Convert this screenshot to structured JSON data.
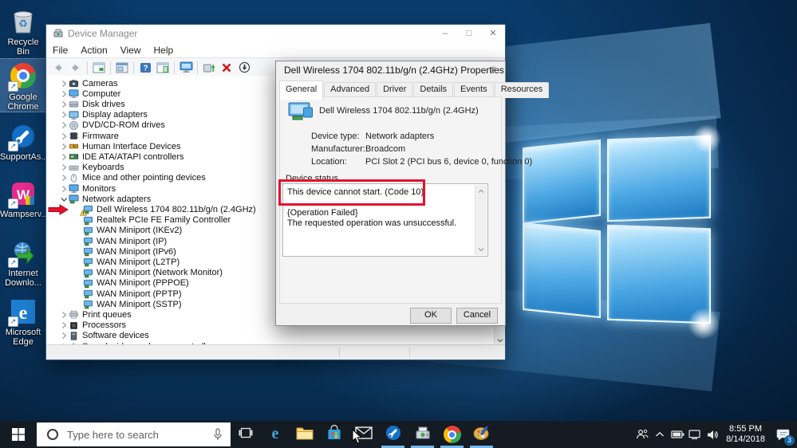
{
  "colors": {
    "accent": "#0078d7",
    "annotation_red": "#e8112d",
    "taskbar_bg": "#151b22",
    "open_app_underline": "#76b9ed",
    "wallpaper_base": "#0e4a82"
  },
  "desktop": {
    "icons": [
      {
        "name": "recycle-bin",
        "label": "Recycle Bin",
        "shortcut": false,
        "selected": false
      },
      {
        "name": "google-chrome",
        "label": "Google\nChrome",
        "shortcut": true,
        "selected": true
      },
      {
        "name": "supportassist",
        "label": "SupportAs...",
        "shortcut": true,
        "selected": false
      },
      {
        "name": "wampserver",
        "label": "Wampserv...",
        "shortcut": true,
        "selected": false
      },
      {
        "name": "internet-download-manager",
        "label": "Internet\nDownlo...",
        "shortcut": true,
        "selected": false
      },
      {
        "name": "microsoft-edge",
        "label": "Microsoft\nEdge",
        "shortcut": true,
        "selected": false
      }
    ]
  },
  "device_manager": {
    "title": "Device Manager",
    "controls": {
      "minimize": "–",
      "maximize": "□",
      "close": "✕"
    },
    "menus": [
      "File",
      "Action",
      "View",
      "Help"
    ],
    "toolbar": [
      "back",
      "forward",
      "sep",
      "show-console-tree",
      "sep",
      "properties-window",
      "sep",
      "help",
      "action-pane",
      "sep",
      "devices-view",
      "sep",
      "update-driver",
      "uninstall-device",
      "disable-device"
    ],
    "tree": [
      {
        "label": "Cameras",
        "icon": "camera",
        "chevron": "collapsed",
        "level": 0
      },
      {
        "label": "Computer",
        "icon": "computer",
        "chevron": "collapsed",
        "level": 0
      },
      {
        "label": "Disk drives",
        "icon": "disk",
        "chevron": "collapsed",
        "level": 0
      },
      {
        "label": "Display adapters",
        "icon": "display",
        "chevron": "collapsed",
        "level": 0
      },
      {
        "label": "DVD/CD-ROM drives",
        "icon": "dvd",
        "chevron": "collapsed",
        "level": 0
      },
      {
        "label": "Firmware",
        "icon": "firmware",
        "chevron": "collapsed",
        "level": 0
      },
      {
        "label": "Human Interface Devices",
        "icon": "hid",
        "chevron": "collapsed",
        "level": 0
      },
      {
        "label": "IDE ATA/ATAPI controllers",
        "icon": "ide",
        "chevron": "collapsed",
        "level": 0
      },
      {
        "label": "Keyboards",
        "icon": "keyboard",
        "chevron": "collapsed",
        "level": 0
      },
      {
        "label": "Mice and other pointing devices",
        "icon": "mouse",
        "chevron": "collapsed",
        "level": 0
      },
      {
        "label": "Monitors",
        "icon": "monitor",
        "chevron": "collapsed",
        "level": 0
      },
      {
        "label": "Network adapters",
        "icon": "network",
        "chevron": "expanded",
        "level": 0
      },
      {
        "label": "Dell Wireless 1704 802.11b/g/n (2.4GHz)",
        "icon": "netadapter",
        "level": 1,
        "warning": true,
        "annotated": true
      },
      {
        "label": "Realtek PCIe FE Family Controller",
        "icon": "netadapter",
        "level": 1
      },
      {
        "label": "WAN Miniport (IKEv2)",
        "icon": "netadapter",
        "level": 1
      },
      {
        "label": "WAN Miniport (IP)",
        "icon": "netadapter",
        "level": 1
      },
      {
        "label": "WAN Miniport (IPv6)",
        "icon": "netadapter",
        "level": 1
      },
      {
        "label": "WAN Miniport (L2TP)",
        "icon": "netadapter",
        "level": 1
      },
      {
        "label": "WAN Miniport (Network Monitor)",
        "icon": "netadapter",
        "level": 1
      },
      {
        "label": "WAN Miniport (PPPOE)",
        "icon": "netadapter",
        "level": 1
      },
      {
        "label": "WAN Miniport (PPTP)",
        "icon": "netadapter",
        "level": 1
      },
      {
        "label": "WAN Miniport (SSTP)",
        "icon": "netadapter",
        "level": 1
      },
      {
        "label": "Print queues",
        "icon": "printer",
        "chevron": "collapsed",
        "level": 0
      },
      {
        "label": "Processors",
        "icon": "processor",
        "chevron": "collapsed",
        "level": 0
      },
      {
        "label": "Software devices",
        "icon": "software",
        "chevron": "collapsed",
        "level": 0
      },
      {
        "label": "Sound, video and game controllers",
        "icon": "sound",
        "chevron": "collapsed",
        "level": 0
      }
    ]
  },
  "dialog": {
    "title": "Dell Wireless 1704 802.11b/g/n (2.4GHz) Properties",
    "close": "✕",
    "tabs": [
      {
        "label": "General",
        "active": true
      },
      {
        "label": "Advanced",
        "active": false
      },
      {
        "label": "Driver",
        "active": false
      },
      {
        "label": "Details",
        "active": false
      },
      {
        "label": "Events",
        "active": false
      },
      {
        "label": "Resources",
        "active": false
      }
    ],
    "device_name": "Dell Wireless 1704 802.11b/g/n (2.4GHz)",
    "fields": [
      {
        "label": "Device type:",
        "value": "Network adapters"
      },
      {
        "label": "Manufacturer:",
        "value": "Broadcom"
      },
      {
        "label": "Location:",
        "value": "PCI Slot 2 (PCI bus 6, device 0, function 0)"
      }
    ],
    "status_label": "Device status",
    "status_lines": [
      "This device cannot start. (Code 10)",
      "",
      "{Operation Failed}",
      "The requested operation was unsuccessful."
    ],
    "ok_label": "OK",
    "cancel_label": "Cancel"
  },
  "taskbar": {
    "search_placeholder": "Type here to search",
    "apps": [
      {
        "name": "task-view",
        "open": false
      },
      {
        "name": "edge",
        "open": false
      },
      {
        "name": "file-explorer",
        "open": false
      },
      {
        "name": "store",
        "open": false
      },
      {
        "name": "mail",
        "open": false
      },
      {
        "name": "supportassist",
        "open": true
      },
      {
        "name": "device-manager",
        "open": true
      },
      {
        "name": "chrome",
        "open": true
      },
      {
        "name": "paint",
        "open": true
      }
    ],
    "tray": {
      "time": "8:55 PM",
      "date": "8/14/2018",
      "notification_count": "3"
    }
  }
}
